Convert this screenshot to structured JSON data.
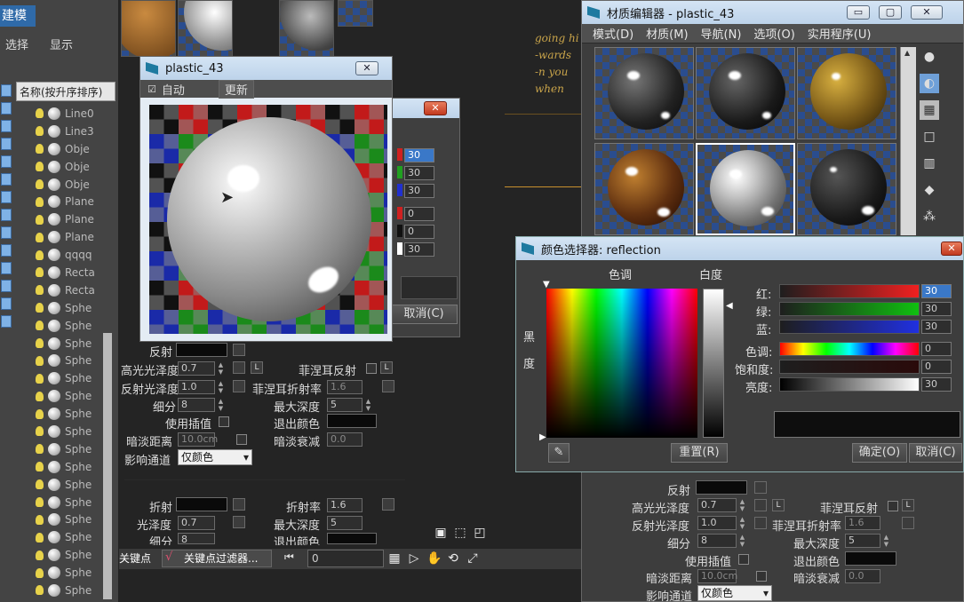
{
  "scene_explorer": {
    "title": "建模",
    "menu_select": "选择",
    "menu_display": "显示",
    "header": "名称(按升序排序)",
    "rows": [
      "Line0",
      "Line3",
      "Obje",
      "Obje",
      "Obje",
      "Plane",
      "Plane",
      "Plane",
      "qqqq",
      "Recta",
      "Recta",
      "Sphe",
      "Sphe",
      "Sphe",
      "Sphe",
      "Sphe",
      "Sphe",
      "Sphe",
      "Sphe",
      "Sphe",
      "Sphe",
      "Sphe",
      "Sphe",
      "Sphe",
      "Sphe",
      "Sphe",
      "Sphe",
      "Sphe"
    ]
  },
  "viewport": {
    "text_lines": [
      "going hi",
      "-wards",
      "-n you",
      "when"
    ],
    "keypoint_label": "关键点",
    "filter_label": "关键点过滤器...",
    "frame_value": "0"
  },
  "preview_window": {
    "title": "plastic_43",
    "auto_label": "自动",
    "update_label": "更新"
  },
  "behind_window": {
    "values": [
      "30",
      "30",
      "30",
      "0",
      "0",
      "30"
    ],
    "cancel_label": "取消(C)"
  },
  "left_panel": {
    "reflect": "反射",
    "highlight_gloss": "高光光泽度",
    "highlight_gloss_value": "0.7",
    "reflect_gloss": "反射光泽度",
    "reflect_gloss_value": "1.0",
    "subdivs": "细分",
    "subdivs_value": "8",
    "use_interp": "使用插值",
    "dim_distance": "暗淡距离",
    "dim_distance_value": "10.0cm",
    "affect_channel": "影响通道",
    "affect_channel_value": "仅颜色",
    "fresnel": "菲涅耳反射",
    "fresnel_ior": "菲涅耳折射率",
    "fresnel_ior_value": "1.6",
    "max_depth": "最大深度",
    "max_depth_value": "5",
    "exit_color": "退出颜色",
    "dim_falloff": "暗淡衰减",
    "dim_falloff_value": "0.0",
    "l_button": "L",
    "refract": "折射",
    "ior": "折射率",
    "ior_value": "1.6",
    "gloss": "光泽度",
    "gloss_value": "0.7",
    "refract_max_depth_value": "5",
    "refract_subdivs": "细分",
    "refract_subdivs_value": "8",
    "refract_exit_color": "退出颜色"
  },
  "material_editor": {
    "title": "材质编辑器 - plastic_43",
    "menu": [
      "模式(D)",
      "材质(M)",
      "导航(N)",
      "选项(O)",
      "实用程序(U)"
    ],
    "props": {
      "reflect": "反射",
      "highlight_gloss": "高光光泽度",
      "highlight_gloss_value": "0.7",
      "reflect_gloss": "反射光泽度",
      "reflect_gloss_value": "1.0",
      "subdivs": "细分",
      "subdivs_value": "8",
      "use_interp": "使用插值",
      "dim_distance": "暗淡距离",
      "dim_distance_value": "10.0cm",
      "affect_channel": "影响通道",
      "affect_channel_value": "仅颜色",
      "fresnel": "菲涅耳反射",
      "fresnel_ior": "菲涅耳折射率",
      "fresnel_ior_value": "1.6",
      "max_depth": "最大深度",
      "max_depth_value": "5",
      "exit_color": "退出颜色",
      "dim_falloff": "暗淡衰减",
      "dim_falloff_value": "0.0",
      "l_button": "L"
    }
  },
  "color_picker": {
    "title": "颜色选择器: reflection",
    "hue_label": "色调",
    "whiteness_label": "白度",
    "blackness_label": "黑",
    "blackness_label2": "度",
    "red_label": "红:",
    "green_label": "绿:",
    "blue_label": "蓝:",
    "hue_field_label": "色调:",
    "saturation_label": "饱和度:",
    "value_label": "亮度:",
    "red_value": "30",
    "green_value": "30",
    "blue_value": "30",
    "hue_value": "0",
    "saturation_value": "0",
    "value_value": "30",
    "reset_label": "重置(R)",
    "ok_label": "确定(O)",
    "cancel_label": "取消(C)"
  },
  "colors": {
    "accent_blue": "#2f6aa8",
    "title_bar": "#c6d9ee",
    "close_red": "#c23a20",
    "panel": "#444444"
  }
}
